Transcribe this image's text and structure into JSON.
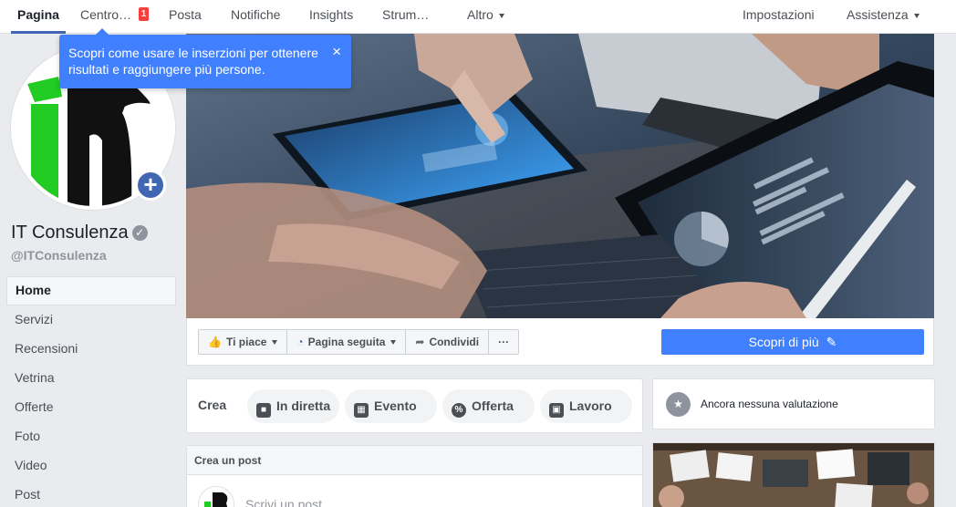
{
  "colors": {
    "accent": "#4267b2",
    "button_blue": "#4080ff",
    "badge_red": "#fa3e3e"
  },
  "topbar": {
    "tabs": [
      {
        "label": "Pagina",
        "active": true
      },
      {
        "label": "Centro…",
        "badge": "1"
      },
      {
        "label": "Posta"
      },
      {
        "label": "Notifiche"
      },
      {
        "label": "Insights"
      },
      {
        "label": "Strum…"
      },
      {
        "label": "Altro",
        "dropdown": true
      }
    ],
    "right": [
      {
        "label": "Impostazioni"
      },
      {
        "label": "Assistenza",
        "dropdown": true
      }
    ]
  },
  "tooltip": {
    "text": "Scopri come usare le inserzioni per ottenere risultati e raggiungere più persone.",
    "close": "×"
  },
  "page": {
    "name": "IT Consulenza",
    "handle": "@ITConsulenza",
    "verified_icon": "check-icon"
  },
  "side_nav": [
    "Home",
    "Servizi",
    "Recensioni",
    "Vetrina",
    "Offerte",
    "Foto",
    "Video",
    "Post"
  ],
  "actions": {
    "like": "Ti piace",
    "follow": "Pagina seguita",
    "share": "Condividi",
    "more": "···",
    "learn_more": "Scopri di più"
  },
  "create": {
    "label": "Crea",
    "pills": [
      "In diretta",
      "Evento",
      "Offerta",
      "Lavoro"
    ]
  },
  "reviews": {
    "text": "Ancora nessuna valutazione"
  },
  "post": {
    "header": "Crea un post",
    "placeholder": "Scrivi un post..."
  }
}
